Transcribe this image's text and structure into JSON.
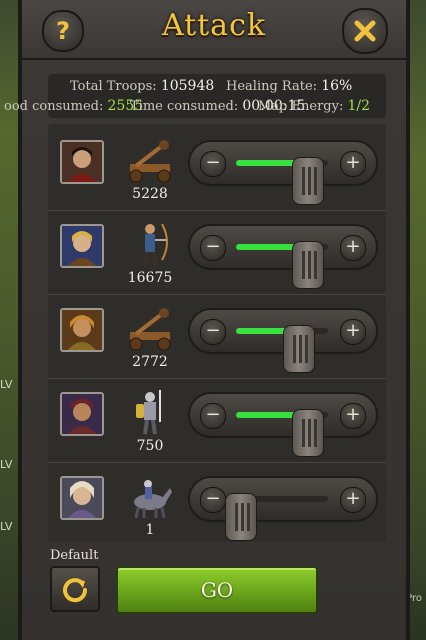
{
  "dialog": {
    "title": "Attack"
  },
  "header": {
    "help_label": "?"
  },
  "stats": {
    "total_troops_label": "Total Troops:",
    "total_troops_value": "105948",
    "healing_rate_label": "Healing Rate:",
    "healing_rate_value": "16%",
    "food_consumed_label": "ood consumed:",
    "food_consumed_value": "2555",
    "time_consumed_label": "Time consumed:",
    "time_consumed_value": "00:00:15",
    "map_energy_label": "Map Energy:",
    "map_energy_value": "1/2"
  },
  "troops": [
    {
      "count": "5228",
      "unit": "catapult",
      "level": 0.78
    },
    {
      "count": "16675",
      "unit": "archer",
      "level": 0.78
    },
    {
      "count": "2772",
      "unit": "catapult",
      "level": 0.68
    },
    {
      "count": "750",
      "unit": "knight",
      "level": 0.78
    },
    {
      "count": "1",
      "unit": "cavalry",
      "level": 0.05
    }
  ],
  "footer": {
    "default_label": "Default",
    "go_label": "GO"
  },
  "background": {
    "lv_label": "LV",
    "pro_label": "Pro"
  },
  "colors": {
    "accent": "#f5c63a",
    "slider_fill": "#37e23e",
    "go_green": "#6aa51b",
    "energy": "#9fe045"
  }
}
